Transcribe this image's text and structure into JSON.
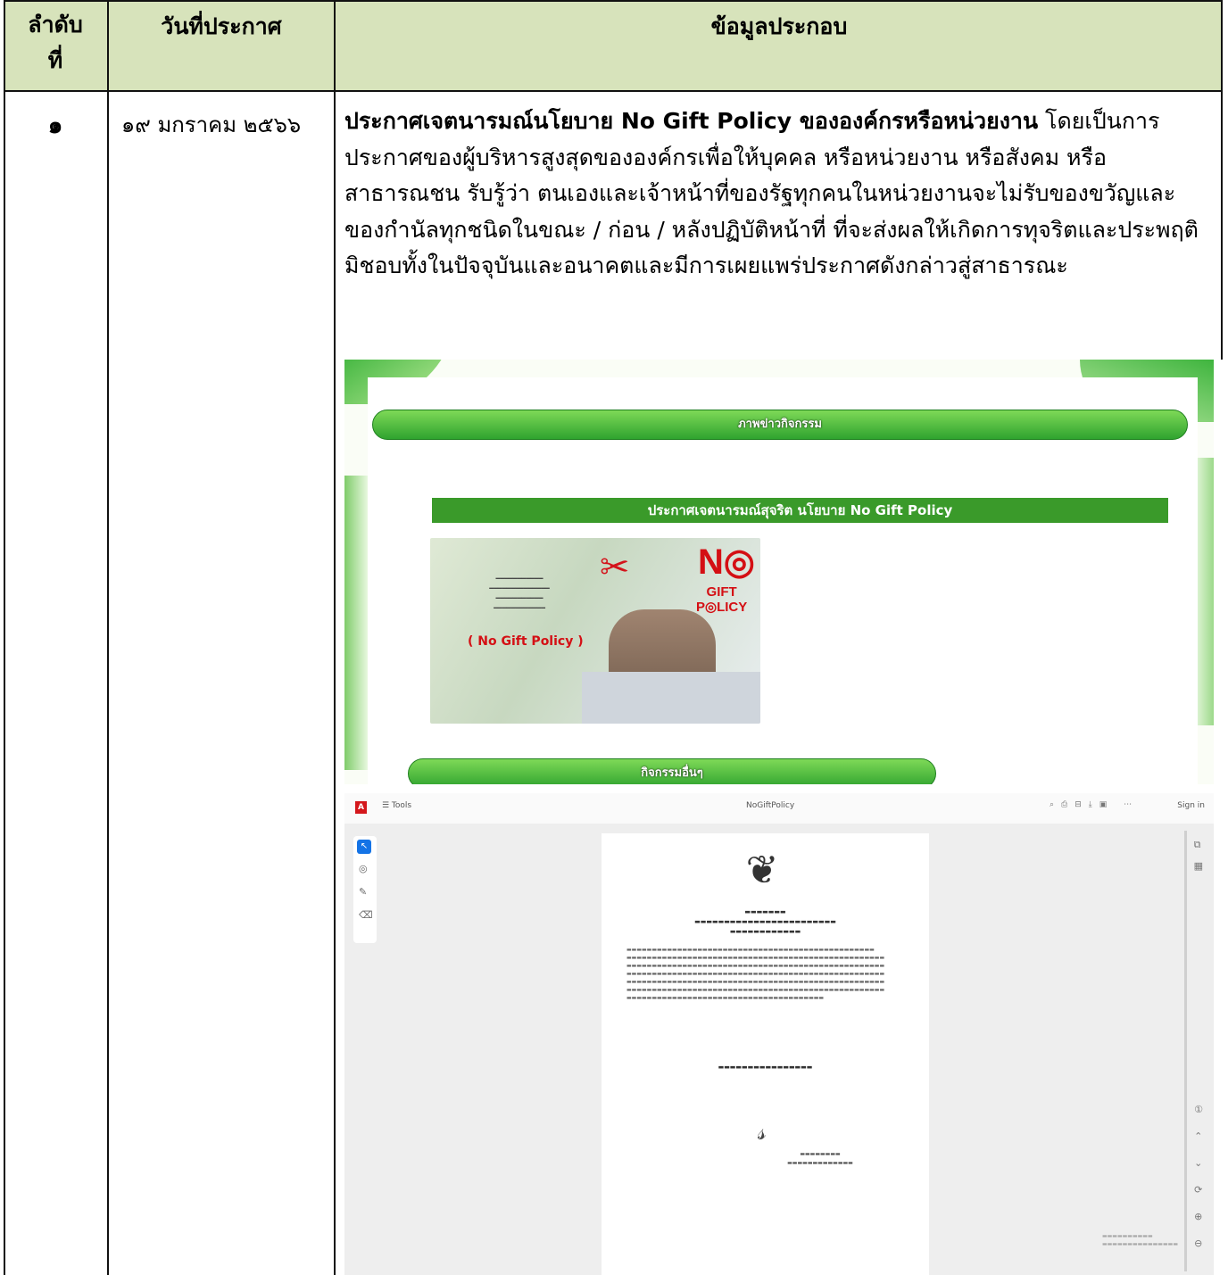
{
  "table": {
    "headers": {
      "col1": "ลำดับ ที่",
      "col2": "วันที่ประกาศ",
      "col3": "ข้อมูลประกอบ"
    },
    "row1": {
      "number": "๑",
      "date": "๑๙ มกราคม ๒๕๖๖",
      "title_bold": "ประกาศเจตนารมณ์นโยบาย No Gift Policy ขององค์กรหรือหน่วยงาน",
      "description": " โดยเป็นการประกาศของผู้บริหารสูงสุดขององค์กรเพื่อให้บุคคล หรือหน่วยงาน หรือสังคม หรือสาธารณชน รับรู้ว่า ตนเองและเจ้าหน้าที่ของรัฐทุกคนในหน่วยงานจะไม่รับของขวัญและของกำนัลทุกชนิดในขณะ / ก่อน / หลังปฏิบัติหน้าที่ ที่จะส่งผลให้เกิดการทุจริตและประพฤติมิชอบทั้งในปัจจุบันและอนาคตและมีการเผยแพร่ประกาศดังกล่าวสู่สาธารณะ"
    }
  },
  "website_screenshot": {
    "section_pill": "ภาพข่าวกิจกรรม",
    "banner": "ประกาศเจตนารมณ์สุจริต นโยบาย No Gift Policy",
    "poster_no": "N◎",
    "poster_gift": "GIFT",
    "poster_policy": "P◎LICY",
    "poster_ngp": "( No Gift Policy )",
    "bottom_pill": "กิจกรรมอื่นๆ"
  },
  "pdf_viewer": {
    "tools_label": "☰ Tools",
    "file_label": "NoGiftPolicy",
    "sign_label": "Sign in"
  },
  "colors": {
    "header_bg": "#d7e3bb",
    "green_accent": "#3a9a2a",
    "pdf_red": "#d4171c"
  }
}
